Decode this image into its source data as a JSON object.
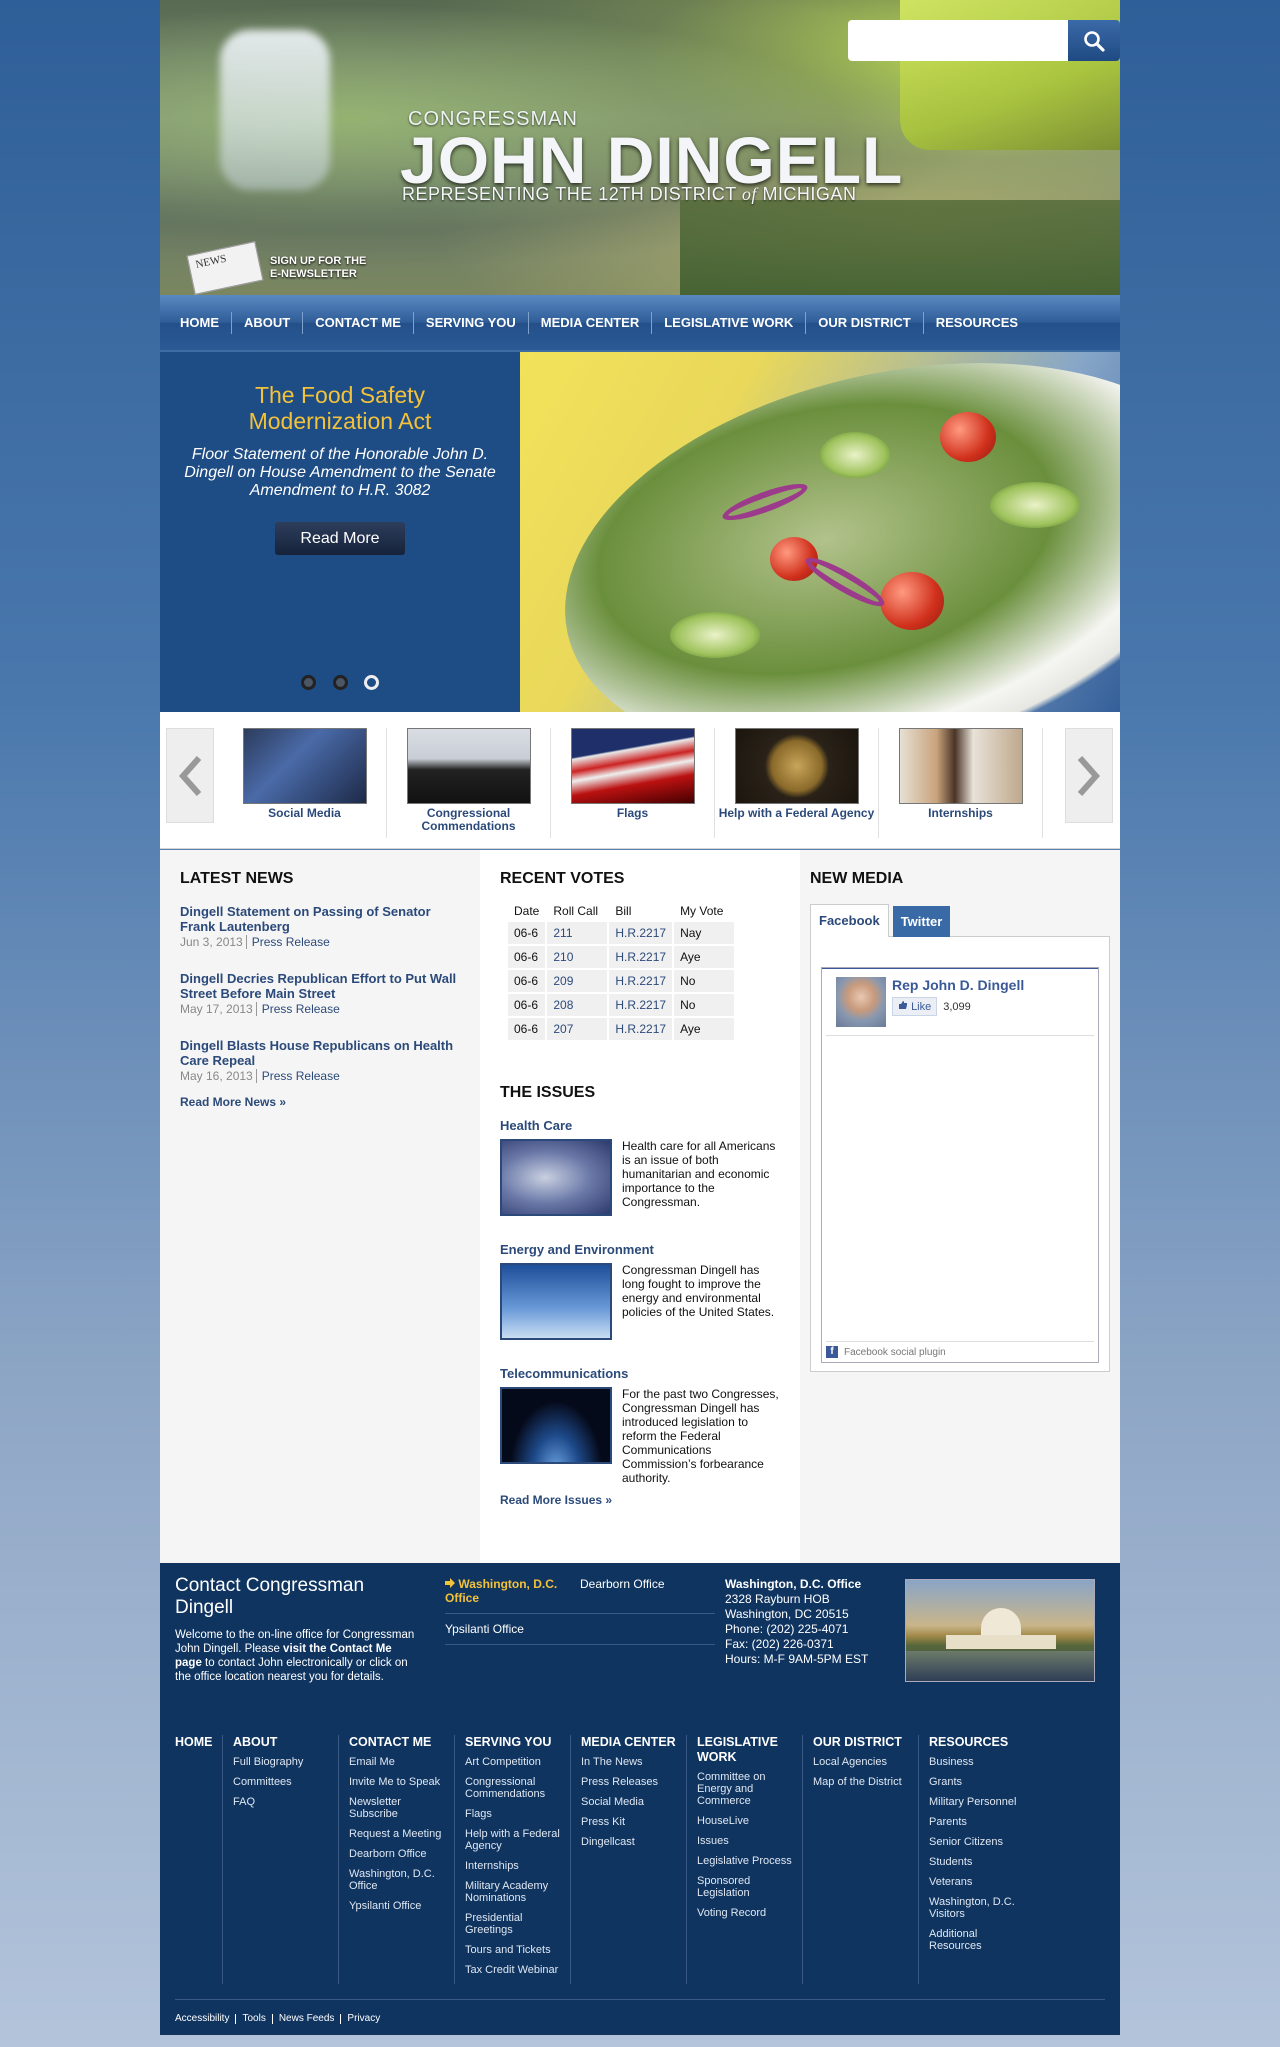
{
  "header": {
    "brand_small": "CONGRESSMAN",
    "brand_big": "JOHN DINGELL",
    "brand_sub_pre": "REPRESENTING THE 12TH DISTRICT",
    "brand_sub_of": "of",
    "brand_sub_post": "MICHIGAN",
    "newsletter_icon_text": "NEWS",
    "newsletter_line1": "SIGN UP FOR THE",
    "newsletter_line2": "E-NEWSLETTER",
    "search_placeholder": "",
    "search_icon": "search-icon"
  },
  "nav": [
    "HOME",
    "ABOUT",
    "CONTACT ME",
    "SERVING YOU",
    "MEDIA CENTER",
    "LEGISLATIVE WORK",
    "OUR DISTRICT",
    "RESOURCES"
  ],
  "hero": {
    "title": "The Food Safety Modernization Act",
    "description": "Floor Statement of the Honorable John D. Dingell on House Amendment to the Senate Amendment to H.R. 3082",
    "button": "Read More",
    "slides": 3,
    "active_slide": 3
  },
  "carousel": [
    {
      "label": "Social Media"
    },
    {
      "label": "Congressional Commendations"
    },
    {
      "label": "Flags"
    },
    {
      "label": "Help with a Federal Agency"
    },
    {
      "label": "Internships"
    }
  ],
  "latest_news": {
    "title": "LATEST NEWS",
    "items": [
      {
        "title": "Dingell Statement on Passing of Senator Frank Lautenberg",
        "date": "Jun 3, 2013",
        "type": "Press Release"
      },
      {
        "title": "Dingell Decries Republican Effort to Put Wall Street Before Main Street",
        "date": "May 17, 2013",
        "type": "Press Release"
      },
      {
        "title": "Dingell Blasts House Republicans on Health Care Repeal",
        "date": "May 16, 2013",
        "type": "Press Release"
      }
    ],
    "more": "Read More News »"
  },
  "recent_votes": {
    "title": "RECENT VOTES",
    "headers": [
      "Date",
      "Roll Call",
      "Bill",
      "My Vote"
    ],
    "rows": [
      [
        "06-6",
        "211",
        "H.R.2217",
        "Nay"
      ],
      [
        "06-6",
        "210",
        "H.R.2217",
        "Aye"
      ],
      [
        "06-6",
        "209",
        "H.R.2217",
        "No"
      ],
      [
        "06-6",
        "208",
        "H.R.2217",
        "No"
      ],
      [
        "06-6",
        "207",
        "H.R.2217",
        "Aye"
      ]
    ]
  },
  "issues": {
    "title": "THE ISSUES",
    "items": [
      {
        "title": "Health Care",
        "text": "Health care for all Americans is an issue of both humanitarian and economic importance to the Congressman."
      },
      {
        "title": "Energy and Environment",
        "text": "Congressman Dingell has long fought to improve the energy and environmental policies of the United States."
      },
      {
        "title": "Telecommunications",
        "text": "For the past two Congresses, Congressman Dingell has introduced legislation to reform the Federal Communications Commission’s forbearance authority."
      }
    ],
    "more": "Read More Issues »"
  },
  "new_media": {
    "title": "NEW MEDIA",
    "tabs": [
      "Facebook",
      "Twitter"
    ],
    "fb_name": "Rep John D. Dingell",
    "fb_like": "Like",
    "fb_count": "3,099",
    "fb_footer": "Facebook social plugin"
  },
  "footer": {
    "contact_title": "Contact Congressman Dingell",
    "contact_text_1": "Welcome to the on-line office for Congressman John Dingell. Please ",
    "contact_text_bold": "visit the Contact Me page",
    "contact_text_2": " to contact John electronically or click on the office location nearest you for details.",
    "offices": [
      "Washington, D.C. Office",
      "Dearborn Office",
      "Ypsilanti Office"
    ],
    "address": {
      "heading": "Washington, D.C. Office",
      "lines": [
        "2328 Rayburn HOB",
        "Washington, DC 20515",
        "Phone: (202) 225-4071",
        "Fax: (202) 226-0371",
        "Hours: M-F 9AM-5PM EST"
      ]
    },
    "sitemap": [
      {
        "head": "HOME",
        "links": []
      },
      {
        "head": "ABOUT",
        "links": [
          "Full Biography",
          "Committees",
          "FAQ"
        ]
      },
      {
        "head": "CONTACT ME",
        "links": [
          "Email Me",
          "Invite Me to Speak",
          "Newsletter Subscribe",
          "Request a Meeting",
          "Dearborn Office",
          "Washington, D.C. Office",
          "Ypsilanti Office"
        ]
      },
      {
        "head": "SERVING YOU",
        "links": [
          "Art Competition",
          "Congressional Commendations",
          "Flags",
          "Help with a Federal Agency",
          "Internships",
          "Military Academy Nominations",
          "Presidential Greetings",
          "Tours and Tickets",
          "Tax Credit Webinar"
        ]
      },
      {
        "head": "MEDIA CENTER",
        "links": [
          "In The News",
          "Press Releases",
          "Social Media",
          "Press Kit",
          "Dingellcast"
        ]
      },
      {
        "head": "LEGISLATIVE WORK",
        "links": [
          "Committee on Energy and Commerce",
          "HouseLive",
          "Issues",
          "Legislative Process",
          "Sponsored Legislation",
          "Voting Record"
        ]
      },
      {
        "head": "OUR DISTRICT",
        "links": [
          "Local Agencies",
          "Map of the District"
        ]
      },
      {
        "head": "RESOURCES",
        "links": [
          "Business",
          "Grants",
          "Military Personnel",
          "Parents",
          "Senior Citizens",
          "Students",
          "Veterans",
          "Washington, D.C. Visitors",
          "Additional Resources"
        ]
      }
    ],
    "legal": [
      "Accessibility",
      "Tools",
      "News Feeds",
      "Privacy"
    ]
  }
}
